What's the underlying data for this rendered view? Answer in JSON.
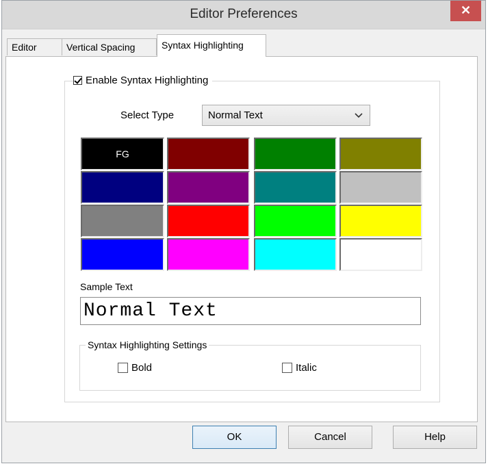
{
  "window": {
    "title": "Editor Preferences",
    "close_glyph": "✕"
  },
  "tabs": [
    {
      "label": "Editor"
    },
    {
      "label": "Vertical Spacing"
    },
    {
      "label": "Syntax Highlighting",
      "active": true
    }
  ],
  "syntax": {
    "enable_label": "Enable Syntax Highlighting",
    "enable_checked": true,
    "select_type_label": "Select Type",
    "select_value": "Normal Text",
    "fg_label": "FG",
    "sample_label": "Sample Text",
    "sample_text": "Normal Text",
    "settings_label": "Syntax Highlighting Settings",
    "bold_label": "Bold",
    "italic_label": "Italic",
    "bold_checked": false,
    "italic_checked": false
  },
  "palette": [
    "#000000",
    "#800000",
    "#008000",
    "#808000",
    "#000080",
    "#800080",
    "#008080",
    "#c0c0c0",
    "#808080",
    "#ff0000",
    "#00ff00",
    "#ffff00",
    "#0000ff",
    "#ff00ff",
    "#00ffff",
    "#ffffff"
  ],
  "buttons": {
    "ok": "OK",
    "cancel": "Cancel",
    "help": "Help"
  }
}
